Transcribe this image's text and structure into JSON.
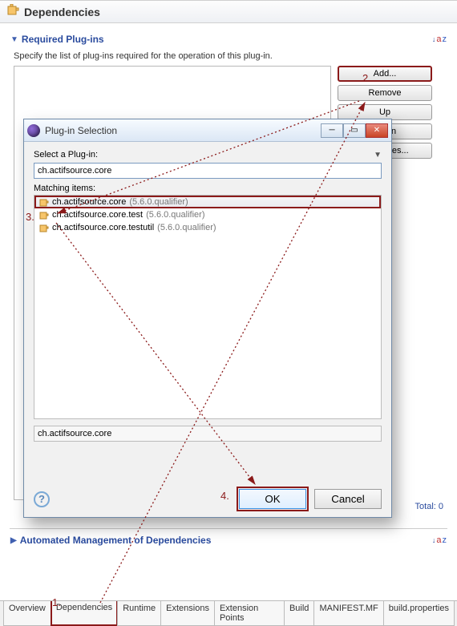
{
  "page": {
    "title": "Dependencies"
  },
  "required": {
    "header": "Required Plug-ins",
    "desc": "Specify the list of plug-ins required for the operation of this plug-in.",
    "buttons": {
      "add": "Add...",
      "remove": "Remove",
      "up": "Up",
      "down": "Down",
      "properties": "Properties..."
    },
    "total_label": "Total: 0",
    "sort_label": "a z"
  },
  "automated": {
    "header": "Automated Management of Dependencies"
  },
  "tabs": [
    "Overview",
    "Dependencies",
    "Runtime",
    "Extensions",
    "Extension Points",
    "Build",
    "MANIFEST.MF",
    "build.properties"
  ],
  "dialog": {
    "title": "Plug-in Selection",
    "select_label": "Select a Plug-in:",
    "filter_value": "ch.actifsource.core",
    "matching_label": "Matching items:",
    "items": [
      {
        "name": "ch.actifsource.core",
        "version": "(5.6.0.qualifier)"
      },
      {
        "name": "ch.actifsource.core.test",
        "version": "(5.6.0.qualifier)"
      },
      {
        "name": "ch.actifsource.core.testutil",
        "version": "(5.6.0.qualifier)"
      }
    ],
    "selected_value": "ch.actifsource.core",
    "ok_label": "OK",
    "cancel_label": "Cancel"
  },
  "markers": {
    "m1": "1.",
    "m2": "2.",
    "m3": "3.",
    "m4": "4."
  }
}
